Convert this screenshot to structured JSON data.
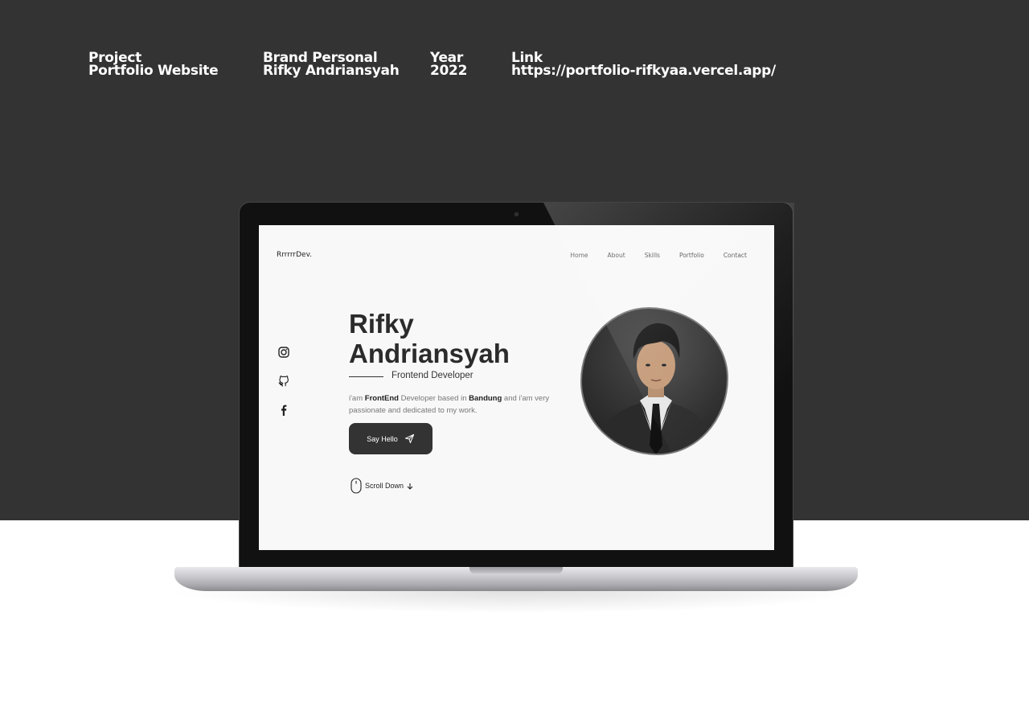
{
  "meta": {
    "project_label": "Project",
    "project_value": "Portfolio Website",
    "brand_label": "Brand Personal",
    "brand_value": "Rifky Andriansyah",
    "year_label": "Year",
    "year_value": "2022",
    "link_label": "Link",
    "link_value": "https://portfolio-rifkyaa.vercel.app/"
  },
  "site": {
    "logo": "RrrrrrDev.",
    "nav": [
      "Home",
      "About",
      "Skills",
      "Portfolio",
      "Contact"
    ],
    "social_icons": [
      "instagram-icon",
      "github-icon",
      "facebook-icon"
    ],
    "hero_first": "Rifky",
    "hero_last": "Andriansyah",
    "role": "Frontend Developer",
    "desc_1": "i'am ",
    "desc_highlight_1": "FrontEnd",
    "desc_2": " Developer based in ",
    "desc_highlight_2": "Bandung",
    "desc_3": " and i'am very passionate and dedicated to my work.",
    "cta": "Say Hello",
    "scroll": "Scroll Down"
  },
  "colors": {
    "background_dark": "#333333",
    "screen_bg": "#f8f8f8",
    "button_bg": "#333333"
  }
}
